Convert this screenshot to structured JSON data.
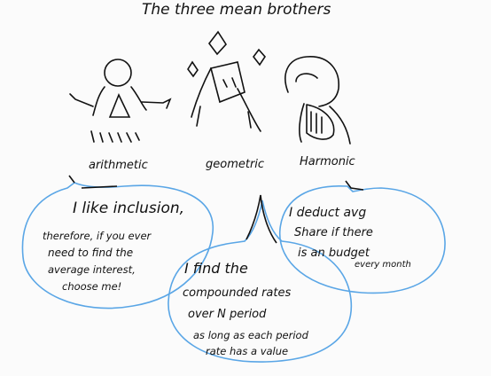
{
  "title": "The three mean brothers",
  "labels": {
    "arithmetic": "arithmetic",
    "geometric": "geometric",
    "harmonic": "Harmonic"
  },
  "bubbles": {
    "arithmetic": [
      "I like inclusion,",
      "therefore, if you ever",
      "need to find the",
      "average interest,",
      "choose me!"
    ],
    "geometric": [
      "I find the",
      "compounded rates",
      "over N period",
      "as long as each period",
      "rate has a value"
    ],
    "harmonic": [
      "I deduct avg",
      "Share if there",
      "is an budget",
      "every month"
    ]
  },
  "colors": {
    "ink": "#111111",
    "bubble_stroke": "#5aa6e6",
    "background": "#fbfbfb"
  }
}
